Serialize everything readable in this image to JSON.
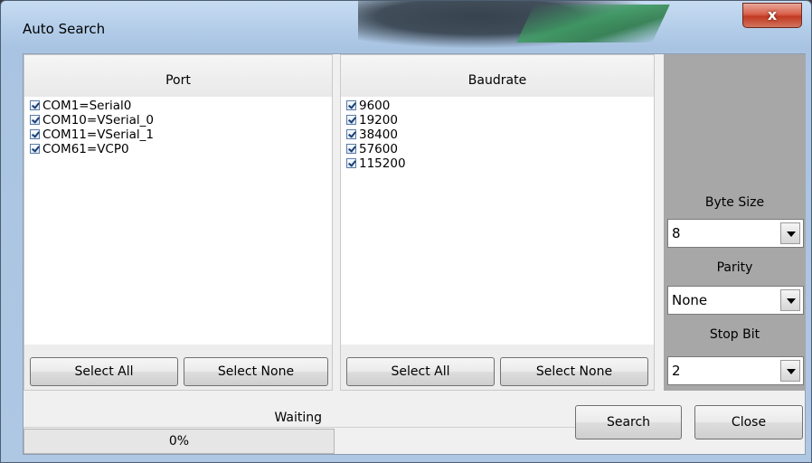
{
  "window": {
    "title": "Auto Search",
    "close_glyph": "x"
  },
  "port_panel": {
    "header": "Port",
    "items": [
      {
        "label": "COM1=Serial0",
        "checked": true
      },
      {
        "label": "COM10=VSerial_0",
        "checked": true
      },
      {
        "label": "COM11=VSerial_1",
        "checked": true
      },
      {
        "label": "COM61=VCP0",
        "checked": true
      }
    ],
    "select_all": "Select All",
    "select_none": "Select None"
  },
  "baud_panel": {
    "header": "Baudrate",
    "items": [
      {
        "label": "9600",
        "checked": true
      },
      {
        "label": "19200",
        "checked": true
      },
      {
        "label": "38400",
        "checked": true
      },
      {
        "label": "57600",
        "checked": true
      },
      {
        "label": "115200",
        "checked": true
      }
    ],
    "select_all": "Select All",
    "select_none": "Select None"
  },
  "settings": {
    "byte_size": {
      "label": "Byte Size",
      "value": "8"
    },
    "parity": {
      "label": "Parity",
      "value": "None"
    },
    "stop_bit": {
      "label": "Stop Bit",
      "value": "2"
    }
  },
  "status": {
    "text": "Waiting",
    "progress_text": "0%",
    "progress": 0
  },
  "buttons": {
    "search": "Search",
    "close": "Close"
  },
  "colors": {
    "side_panel": "#a7a7a7",
    "progress_fill": "#37b24d",
    "close_button": "#c23a22"
  }
}
